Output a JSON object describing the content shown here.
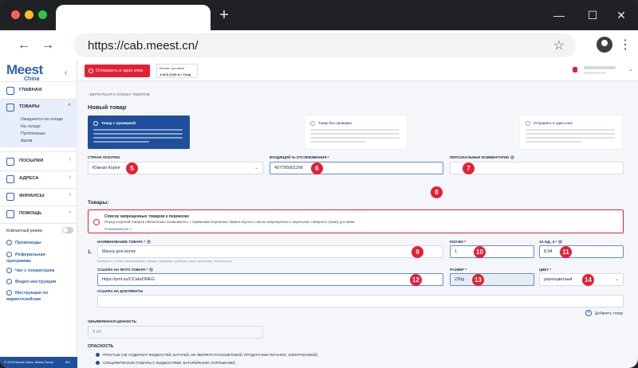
{
  "browser": {
    "url": "https://cab.meest.cn/",
    "new_tab_label": "+",
    "win_min": "—",
    "win_max": "☐",
    "win_close": "✕",
    "back_icon": "←",
    "forward_icon": "→",
    "star_icon": "☆",
    "menu_icon": "⋮"
  },
  "brand": {
    "logo": "Meest",
    "sub": "China",
    "color": "#2e63b0"
  },
  "sidebar": {
    "collapse_icon": "‹",
    "items": [
      {
        "label": "ГЛАВНАЯ",
        "chev": ""
      },
      {
        "label": "ТОВАРЫ",
        "chev": "˄"
      },
      {
        "label": "ПОСЫЛКИ",
        "chev": "›"
      },
      {
        "label": "АДРЕСА",
        "chev": "›"
      },
      {
        "label": "ФИНАНСЫ",
        "chev": "›"
      },
      {
        "label": "ПОМОЩЬ",
        "chev": "›"
      }
    ],
    "sub_items": [
      "Ожидаются на складе",
      "На складе",
      "Проблемные",
      "Архив"
    ],
    "compact_mode": "Компактный режим",
    "links": [
      "Промокоды",
      "Реферальная программа",
      "Чат с оператором",
      "Видео инструкция",
      "Инструкции по маркетплейсам"
    ],
    "footer": "© 2025 Meest China, Meest Group",
    "footer_lang": "RU"
  },
  "header": {
    "send_button": "Отправить в один клик",
    "balance_label": "Баланс, доставка",
    "balance_value": "1.03 $ (0,00 кг / Тегр)"
  },
  "main": {
    "back_link": "ВЕРНУТЬСЯ К СПИСКУ ТОВАРОВ",
    "title": "Новый товар",
    "cards": [
      {
        "title": "Товар с проверкой",
        "selected": true
      },
      {
        "title": "Товар без проверки",
        "selected": false
      },
      {
        "title": "Отправить в один клик",
        "selected": false
      }
    ],
    "country_label": "СТРАНА ПОКУПКИ",
    "country_value": "Южная Корея",
    "tracking_label": "ВХОДЯЩИЙ № ОТСЛЕЖИВАНИЯ *",
    "tracking_value": "407795001296",
    "comments_label": "ПЕРСОНАЛЬНЫЕ КОММЕНТАРИИ",
    "goods_heading": "Товары:",
    "alert_title": "Список запрещенных товаров к перевозке",
    "alert_body": "Перед покупкой товаров обязательно ознакомьтесь с правилами перевозки. Важно изучить список запрещенных к пересылке товаров в страну доставки.",
    "alert_link": "Ознакомиться >",
    "row_number": "1.",
    "name_label": "НАИМЕНОВАНИЕ ТОВАРА *",
    "name_value": "Маска для волос",
    "name_hint": "Выберите точное наименование товара, например: рубашка, ваза, кроссовки, конструктор",
    "qty_label": "КОЛ-ВО *",
    "qty_value": "1",
    "price_label": "ЗА ЕД., $ *",
    "price_value": "8.94",
    "photo_label": "ССЫЛКА НА ФОТО ТОВАРА *",
    "photo_value": "https://pmt.su/CCakzD6lEG",
    "size_label": "РАЗМЕР *",
    "size_value": "230g",
    "color_label": "ЦВЕТ *",
    "color_value": "разноцветный",
    "docs_label": "ССЫЛКА НА ДОКУМЕНТЫ",
    "add_product": "Добавить товар",
    "declared_label": "ОБЪЯВЛЕННАЯ ЦЕННОСТЬ",
    "declared_value": "8.94",
    "danger_label": "ОПАСНОСТЬ",
    "danger_options": [
      "ПРОСТЫЕ (НЕ СОДЕРЖАТ ЖИДКОСТЕЙ, БАТАРЕЙ, НЕ ЯВЛЯЮТСЯ КОСМЕТИКОЙ, ПРОДУКТАМИ ПИТАНИЯ, ЭЛЕКТРОНИКОЙ)",
      "СПЕЦИФИЧЕСКИЕ (ТОВАРЫ С ЖИДКОСТЯМИ, БАТАРЕЙКАМИ, ПОРОШКАМИ)"
    ]
  },
  "badges": [
    "5",
    "6",
    "7",
    "8",
    "9",
    "10",
    "11",
    "12",
    "13",
    "14"
  ],
  "colors": {
    "accent": "#e42034",
    "primary": "#1f4f9a"
  }
}
